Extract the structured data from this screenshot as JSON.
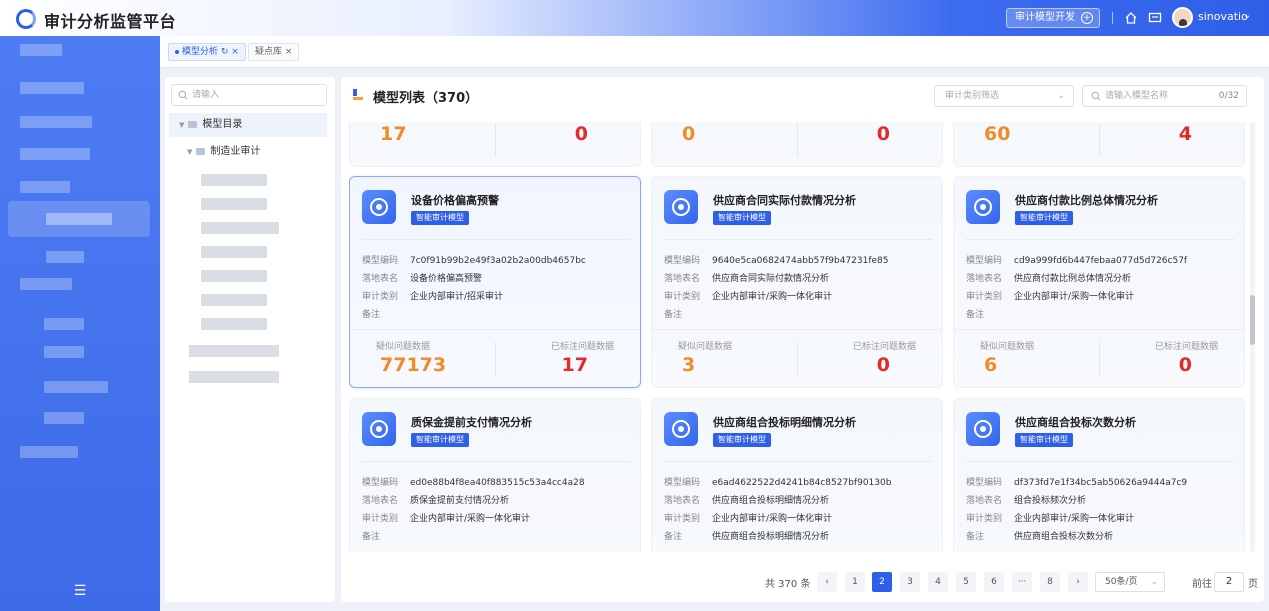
{
  "app": {
    "title": "审计分析监管平台"
  },
  "header": {
    "dev_button": "审计模型开发",
    "user_name": "sinovatio"
  },
  "tabs": [
    {
      "label": "模型分析",
      "active": true
    },
    {
      "label": "疑点库",
      "active": false
    }
  ],
  "tree": {
    "search_placeholder": "请输入",
    "root_label": "模型目录",
    "child_label": "制造业审计"
  },
  "list": {
    "title": "模型列表（370）",
    "type_filter_placeholder": "审计类别筛选",
    "search_placeholder": "请输入模型名称",
    "search_count": "0/32"
  },
  "labels": {
    "code": "模型编码",
    "table": "落地表名",
    "category": "审计类别",
    "remark": "备注",
    "suspect": "疑似问题数据",
    "marked": "已标注问题数据",
    "tag": "智能审计模型"
  },
  "partial_cards": [
    {
      "suspect": "17",
      "marked": "0"
    },
    {
      "suspect": "0",
      "marked": "0"
    },
    {
      "suspect": "60",
      "marked": "4"
    }
  ],
  "cards": [
    {
      "title": "设备价格偏高预警",
      "code": "7c0f91b99b2e49f3a02b2a00db4657bc",
      "table": "设备价格偏高预警",
      "category": "企业内部审计/招采审计",
      "remark": "",
      "suspect": "77173",
      "marked": "17",
      "selected": true
    },
    {
      "title": "供应商合同实际付款情况分析",
      "code": "9640e5ca0682474abb57f9b47231fe85",
      "table": "供应商合同实际付款情况分析",
      "category": "企业内部审计/采购一体化审计",
      "remark": "",
      "suspect": "3",
      "marked": "0",
      "selected": false
    },
    {
      "title": "供应商付款比例总体情况分析",
      "code": "cd9a999fd6b447febaa077d5d726c57f",
      "table": "供应商付款比例总体情况分析",
      "category": "企业内部审计/采购一体化审计",
      "remark": "",
      "suspect": "6",
      "marked": "0",
      "selected": false
    },
    {
      "title": "质保金提前支付情况分析",
      "code": "ed0e88b4f8ea40f883515c53a4cc4a28",
      "table": "质保金提前支付情况分析",
      "category": "企业内部审计/采购一体化审计",
      "remark": "",
      "selected": false
    },
    {
      "title": "供应商组合投标明细情况分析",
      "code": "e6ad4622522d4241b84c8527bf90130b",
      "table": "供应商组合投标明细情况分析",
      "category": "企业内部审计/采购一体化审计",
      "remark": "供应商组合投标明细情况分析",
      "selected": false
    },
    {
      "title": "供应商组合投标次数分析",
      "code": "df373fd7e1f34bc5ab50626a9444a7c9",
      "table": "组合投标频次分析",
      "category": "企业内部审计/采购一体化审计",
      "remark": "供应商组合投标次数分析",
      "selected": false
    }
  ],
  "pagination": {
    "total": "共 370 条",
    "pages": [
      "1",
      "2",
      "3",
      "4",
      "5",
      "6",
      "···",
      "8"
    ],
    "active_page": "2",
    "page_size": "50条/页",
    "goto_label": "前往",
    "goto_value": "2",
    "page_unit": "页"
  },
  "colors": {
    "primary": "#2f5fe8",
    "suspect_value": "#f08b2a",
    "marked_value": "#e12b2b"
  }
}
